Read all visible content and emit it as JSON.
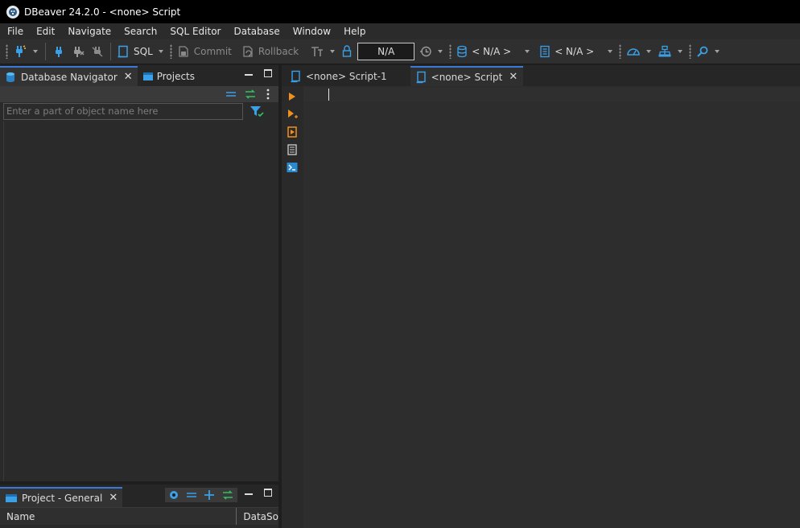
{
  "window": {
    "title": "DBeaver 24.2.0 - <none> Script"
  },
  "menu": {
    "items": [
      "File",
      "Edit",
      "Navigate",
      "Search",
      "SQL Editor",
      "Database",
      "Window",
      "Help"
    ]
  },
  "toolbar": {
    "sql_label": "SQL",
    "commit_label": "Commit",
    "rollback_label": "Rollback",
    "transaction_value": "N/A",
    "datasource_label": "< N/A >",
    "schema_label": "< N/A >"
  },
  "left_panel": {
    "tabs": [
      {
        "label": "Database Navigator",
        "active": true
      },
      {
        "label": "Projects",
        "active": false
      }
    ],
    "filter_placeholder": "Enter a part of object name here"
  },
  "project_panel": {
    "tab_label": "Project - General",
    "columns": [
      "Name",
      "DataSo"
    ]
  },
  "editor": {
    "tabs": [
      {
        "label": "<none> Script-1",
        "active": false
      },
      {
        "label": "<none> Script",
        "active": true
      }
    ]
  },
  "colors": {
    "accent": "#3a7ad6",
    "orange": "#f0901e",
    "teal": "#26a9e0",
    "background": "#2b2b2b"
  },
  "icons": {
    "gutter": [
      "execute-statement-icon",
      "execute-in-new-tab-icon",
      "execute-script-icon",
      "explain-plan-icon",
      "open-console-icon"
    ]
  }
}
